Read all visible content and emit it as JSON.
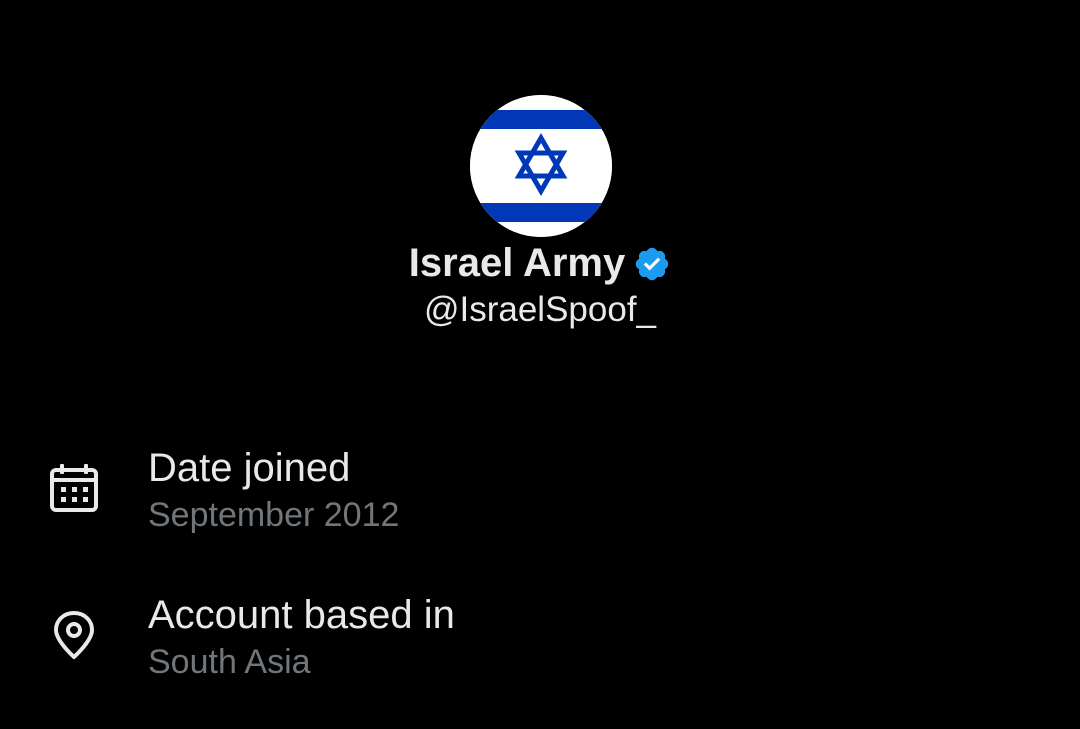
{
  "profile": {
    "display_name": "Israel Army",
    "handle": "@IsraelSpoof_",
    "verified_icon": "verified-badge-icon",
    "avatar": "israel-flag-avatar"
  },
  "about": {
    "joined": {
      "icon": "calendar-icon",
      "label": "Date joined",
      "value": "September 2012"
    },
    "location": {
      "icon": "location-pin-icon",
      "label": "Account based in",
      "value": "South Asia"
    }
  },
  "colors": {
    "background": "#000000",
    "primary_text": "#e7e9ea",
    "secondary_text": "#71767b",
    "verified_blue": "#1d9bf0",
    "flag_blue": "#0038b8",
    "flag_white": "#ffffff"
  }
}
